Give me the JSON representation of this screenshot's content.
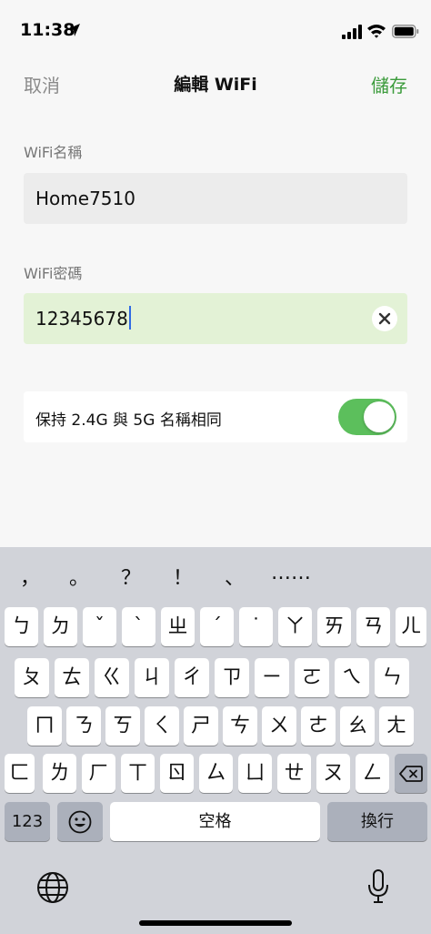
{
  "status_bar": {
    "time": "11:38"
  },
  "nav": {
    "cancel": "取消",
    "title": "編輯 WiFi",
    "save": "儲存"
  },
  "form": {
    "name_label": "WiFi名稱",
    "name_value": "Home7510",
    "password_label": "WiFi密碼",
    "password_value": "12345678",
    "toggle_label": "保持 2.4G 與 5G 名稱相同",
    "toggle_on": true
  },
  "colors": {
    "accent": "#3b9b3b",
    "toggle_on": "#5cbf5c",
    "password_bg": "#e3f2d6"
  },
  "keyboard": {
    "punctuation": [
      "，",
      "。",
      "？",
      "！",
      "、",
      "……"
    ],
    "row1": [
      "ㄅ",
      "ㄉ",
      "ˇ",
      "ˋ",
      "ㄓ",
      "ˊ",
      "˙",
      "ㄚ",
      "ㄞ",
      "ㄢ",
      "ㄦ"
    ],
    "row2": [
      "ㄆ",
      "ㄊ",
      "ㄍ",
      "ㄐ",
      "ㄔ",
      "ㄗ",
      "ㄧ",
      "ㄛ",
      "ㄟ",
      "ㄣ"
    ],
    "row3": [
      "ㄇ",
      "ㄋ",
      "ㄎ",
      "ㄑ",
      "ㄕ",
      "ㄘ",
      "ㄨ",
      "ㄜ",
      "ㄠ",
      "ㄤ"
    ],
    "row4": [
      "ㄈ",
      "ㄌ",
      "ㄏ",
      "ㄒ",
      "ㄖ",
      "ㄙ",
      "ㄩ",
      "ㄝ",
      "ㄡ",
      "ㄥ"
    ],
    "numbers_key": "123",
    "space_key": "空格",
    "return_key": "換行",
    "icons": [
      "emoji-icon",
      "backspace-icon",
      "globe-icon",
      "microphone-icon"
    ]
  }
}
